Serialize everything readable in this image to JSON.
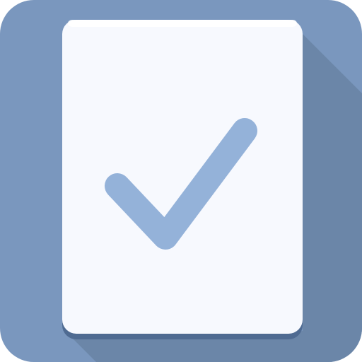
{
  "icon": {
    "name": "task-checklist-app-icon",
    "glyph": "checkmark-icon"
  },
  "colors": {
    "tile": "#7A97BE",
    "long_shadow": "#6B86A8",
    "card_edge": "#4F6B92",
    "card": "#F7F9FE",
    "card_top_highlight": "#FFFFFF",
    "check": "#94B2D9"
  }
}
